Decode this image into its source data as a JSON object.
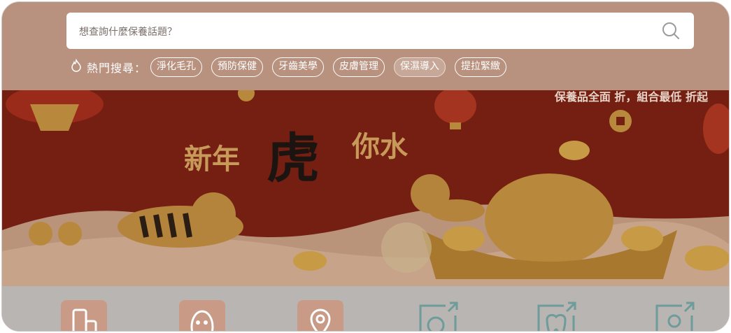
{
  "search": {
    "placeholder": "想查詢什麼保養話題？"
  },
  "hot_search": {
    "label": "熱門搜尋：",
    "chips": [
      "淨化毛孔",
      "預防保健",
      "牙齒美學",
      "皮膚管理",
      "保濕導入",
      "提拉緊緻"
    ],
    "active_index": 4
  },
  "banner": {
    "top_text": "保養品全面 折，組合最低 折起",
    "title_left": "新年",
    "title_center": "虎",
    "title_right": "你水"
  },
  "colors": {
    "search_area": "#b8917f",
    "banner_red": "#6e1c10",
    "gold": "#c89a5a",
    "icon_row": "#b9b5b3",
    "icon_fill": "#c99a86"
  },
  "category_icons": [
    "lotion-icon",
    "mask-icon",
    "location-icon",
    "search-zoom-icon",
    "tooth-icon",
    "user-icon"
  ]
}
